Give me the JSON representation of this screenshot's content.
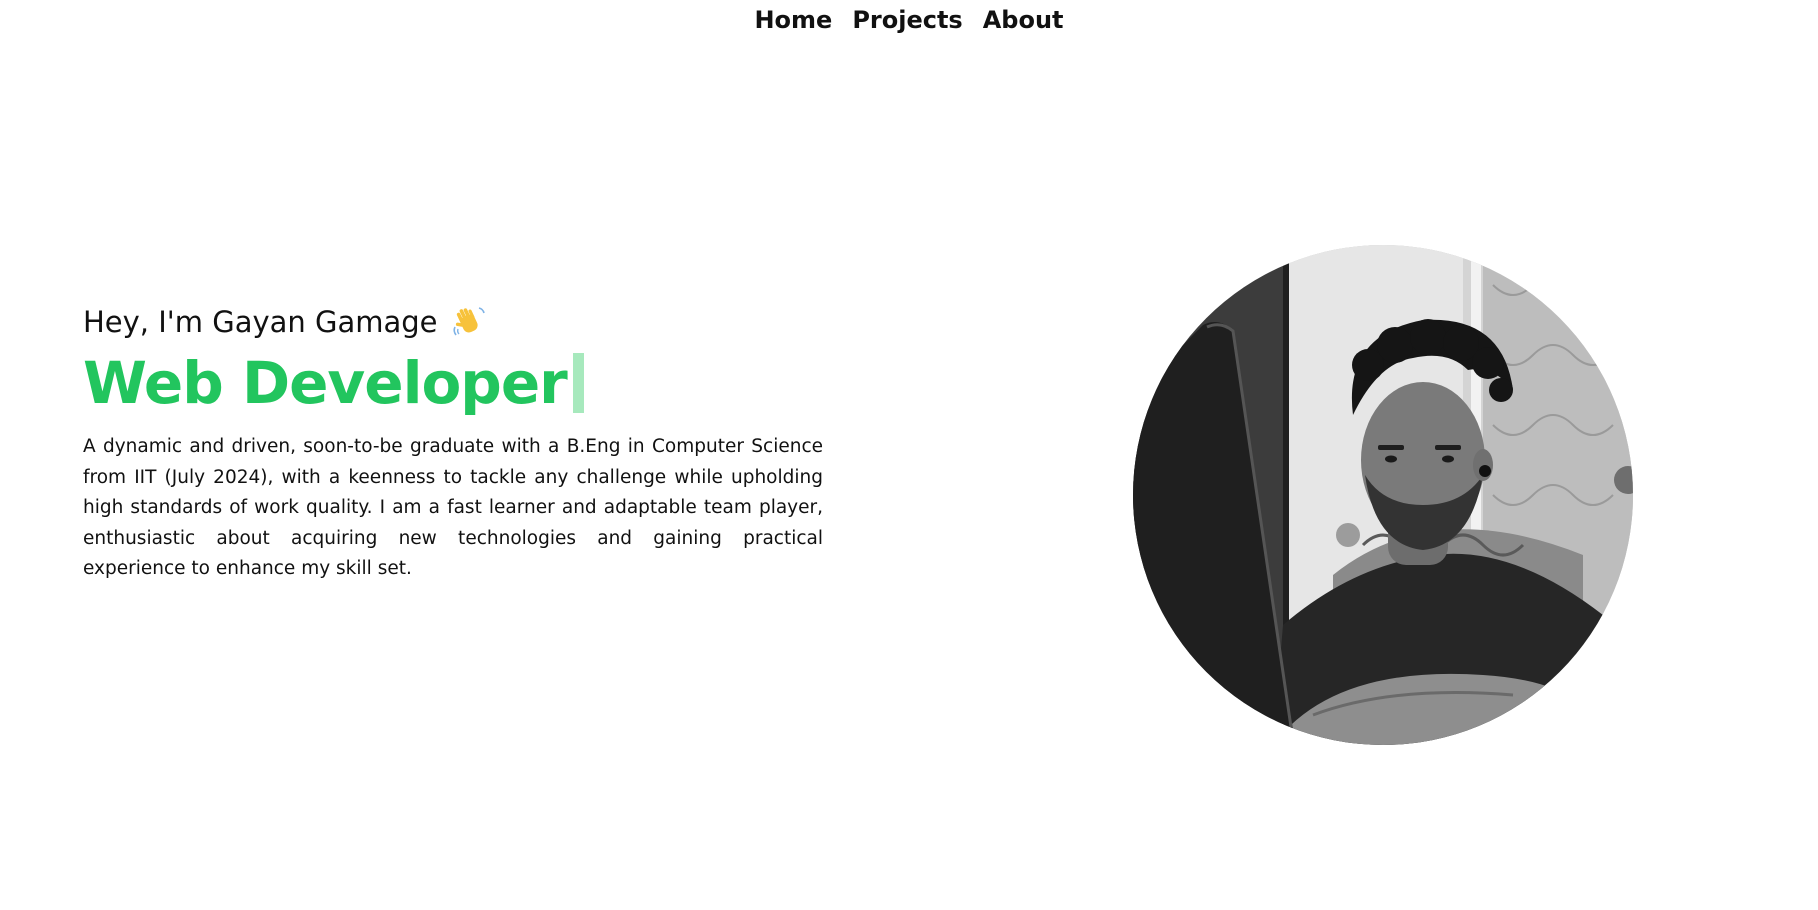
{
  "nav": {
    "items": [
      {
        "label": "Home"
      },
      {
        "label": "Projects"
      },
      {
        "label": "About"
      }
    ]
  },
  "hero": {
    "greeting": "Hey, I'm Gayan Gamage",
    "greeting_icon": "waving-hand-icon",
    "role": "Web Developer",
    "bio": "A dynamic and driven, soon-to-be graduate with a B.Eng in Computer Science from IIT (July 2024), with a keenness to tackle any challenge while upholding high standards of work quality. I am a fast learner and adaptable team player, enthusiastic about acquiring new technologies and gaining practical experience to enhance my skill set."
  },
  "portrait": {
    "icon": "profile-photo"
  },
  "colors": {
    "accent": "#22c55e",
    "cursor": "#a7e9bd",
    "text": "#111111",
    "background": "#ffffff"
  }
}
